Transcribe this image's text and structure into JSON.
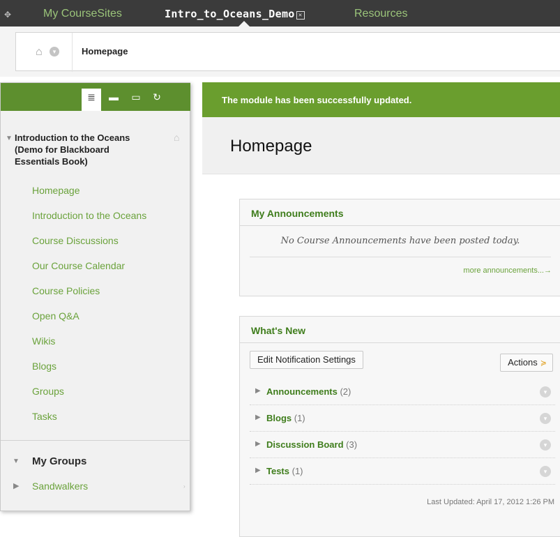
{
  "topnav": {
    "tabs": [
      {
        "label": "My CourseSites"
      },
      {
        "label": "Intro_to_Oceans_Demo",
        "close": "✕"
      },
      {
        "label": "Resources"
      }
    ]
  },
  "breadcrumb": {
    "title": "Homepage"
  },
  "course_menu": {
    "course_title": "Introduction to the Oceans (Demo for Blackboard Essentials Book)",
    "items": [
      {
        "label": "Homepage"
      },
      {
        "label": "Introduction to the Oceans"
      },
      {
        "label": "Course Discussions"
      },
      {
        "label": "Our Course Calendar"
      },
      {
        "label": "Course Policies"
      },
      {
        "label": "Open Q&A"
      },
      {
        "label": "Wikis"
      },
      {
        "label": "Blogs"
      },
      {
        "label": "Groups"
      },
      {
        "label": "Tasks"
      }
    ],
    "groups_heading": "My Groups",
    "groups": [
      {
        "label": "Sandwalkers"
      }
    ]
  },
  "content": {
    "success_message": "The module has been successfully updated.",
    "page_title": "Homepage",
    "announcements": {
      "title": "My Announcements",
      "empty_text": "No Course Announcements have been posted today.",
      "more_link": "more announcements...→"
    },
    "whats_new": {
      "title": "What's New",
      "edit_button": "Edit Notification Settings",
      "actions_button": "Actions",
      "rows": [
        {
          "label": "Announcements",
          "count": "(2)"
        },
        {
          "label": "Blogs",
          "count": "(1)"
        },
        {
          "label": "Discussion Board",
          "count": "(3)"
        },
        {
          "label": "Tests",
          "count": "(1)"
        }
      ],
      "last_updated": "Last Updated: April 17, 2012 1:26 PM"
    }
  },
  "colors": {
    "brand_green": "#6a9e2e",
    "link_green": "#6aa23b",
    "topnav": "#3b3b3b"
  }
}
